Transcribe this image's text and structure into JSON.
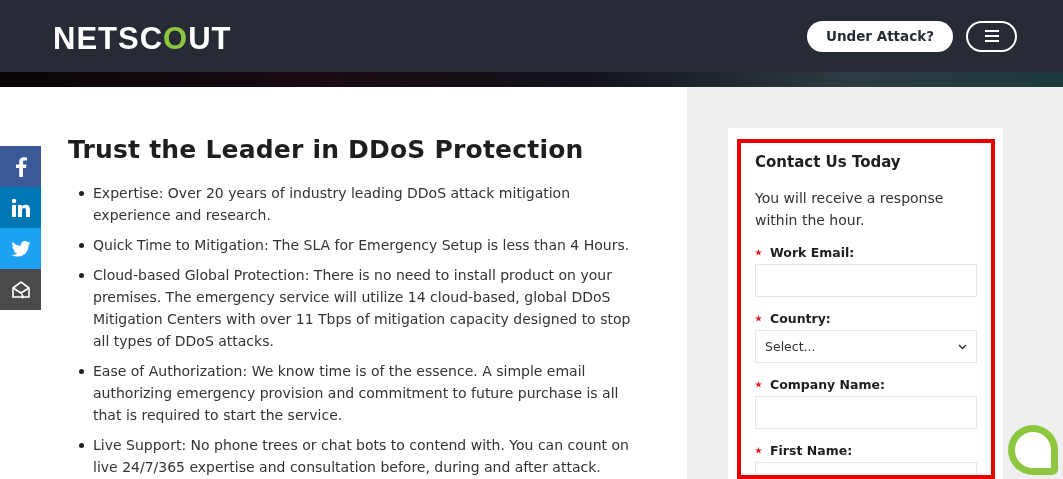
{
  "header": {
    "logo": {
      "before": "NETSC",
      "accent": "O",
      "after": "UT"
    },
    "attack_button": "Under Attack?"
  },
  "social": [
    {
      "kind": "facebook",
      "color": "#3b5998"
    },
    {
      "kind": "linkedin",
      "color": "#0077b5"
    },
    {
      "kind": "twitter",
      "color": "#1da1f2"
    },
    {
      "kind": "email",
      "color": "#4a4a4a"
    }
  ],
  "heading": "Trust the Leader in DDoS Protection",
  "bullets": [
    "Expertise: Over 20 years of industry leading DDoS attack mitigation experience and research.",
    "Quick Time to Mitigation: The SLA for Emergency Setup is less than 4 Hours.",
    "Cloud-based Global Protection: There is no need to install product on your premises. The emergency service will utilize 14 cloud-based, global DDoS Mitigation Centers with over 11 Tbps of mitigation capacity designed to stop all types of DDoS attacks.",
    "Ease of Authorization: We know time is of the essence. A simple email authorizing emergency provision and commitment to future purchase is all that is required to start the service.",
    "Live Support: No phone trees or chat bots to contend with. You can count on live 24/7/365 expertise and consultation before, during and after attack."
  ],
  "form": {
    "title": "Contact Us Today",
    "intro": "You will receive a response within the hour.",
    "fields": [
      {
        "label": "Work Email:",
        "required": true,
        "kind": "input"
      },
      {
        "label": "Country:",
        "required": true,
        "kind": "select",
        "value": "Select..."
      },
      {
        "label": "Company Name:",
        "required": true,
        "kind": "input"
      },
      {
        "label": "First Name:",
        "required": true,
        "kind": "input"
      }
    ]
  }
}
